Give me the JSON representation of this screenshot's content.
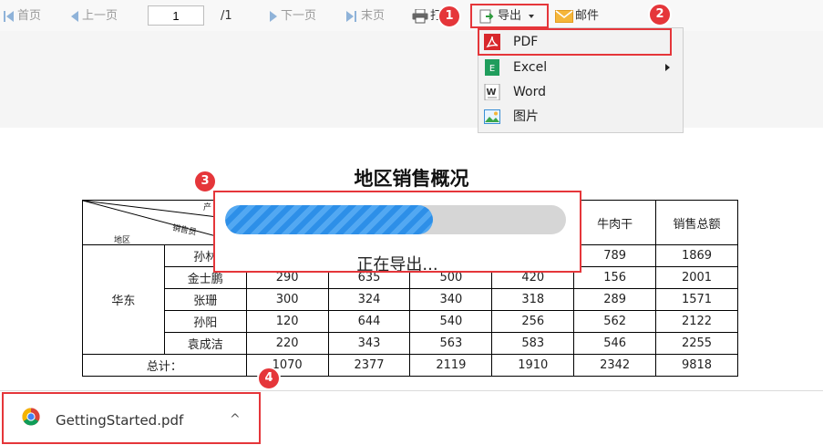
{
  "toolbar": {
    "first_page": "首页",
    "prev_page": "上一页",
    "page_value": "1",
    "page_total": "/1",
    "next_page": "下一页",
    "last_page": "末页",
    "print": "打",
    "export": "导出",
    "mail": "邮件"
  },
  "export_menu": {
    "items": [
      {
        "label": "PDF",
        "icon": "pdf-icon"
      },
      {
        "label": "Excel",
        "icon": "excel-icon"
      },
      {
        "label": "Word",
        "icon": "word-icon"
      },
      {
        "label": "图片",
        "icon": "image-icon"
      }
    ]
  },
  "badges": [
    "1",
    "2",
    "3",
    "4"
  ],
  "report": {
    "title": "地区销售概况",
    "header_diag_region": "地区",
    "header_diag_salesperson": "销售员",
    "header_diag_product": "产",
    "header_cols": [
      "牛肉干",
      "销售总额"
    ],
    "region": "华东",
    "rows": [
      {
        "name": "孙林",
        "v": [
          "",
          "",
          "",
          "",
          "789",
          "1869"
        ]
      },
      {
        "name": "金士鹏",
        "v": [
          "290",
          "635",
          "500",
          "420",
          "156",
          "2001"
        ]
      },
      {
        "name": "张珊",
        "v": [
          "300",
          "324",
          "340",
          "318",
          "289",
          "1571"
        ]
      },
      {
        "name": "孙阳",
        "v": [
          "120",
          "644",
          "540",
          "256",
          "562",
          "2122"
        ]
      },
      {
        "name": "袁成洁",
        "v": [
          "220",
          "343",
          "563",
          "583",
          "546",
          "2255"
        ]
      }
    ],
    "total_label": "总计：",
    "totals": [
      "1070",
      "2377",
      "2119",
      "1910",
      "2342",
      "9818"
    ]
  },
  "progress": {
    "text": "正在导出...",
    "value": 0.61,
    "color": "#2d8fe8"
  },
  "download": {
    "filename": "GettingStarted.pdf",
    "chevron": "^"
  },
  "colors": {
    "highlight": "#e5363a",
    "toolbar_bg": "#f8f8f8",
    "menu_bg": "#f2f2f2"
  }
}
